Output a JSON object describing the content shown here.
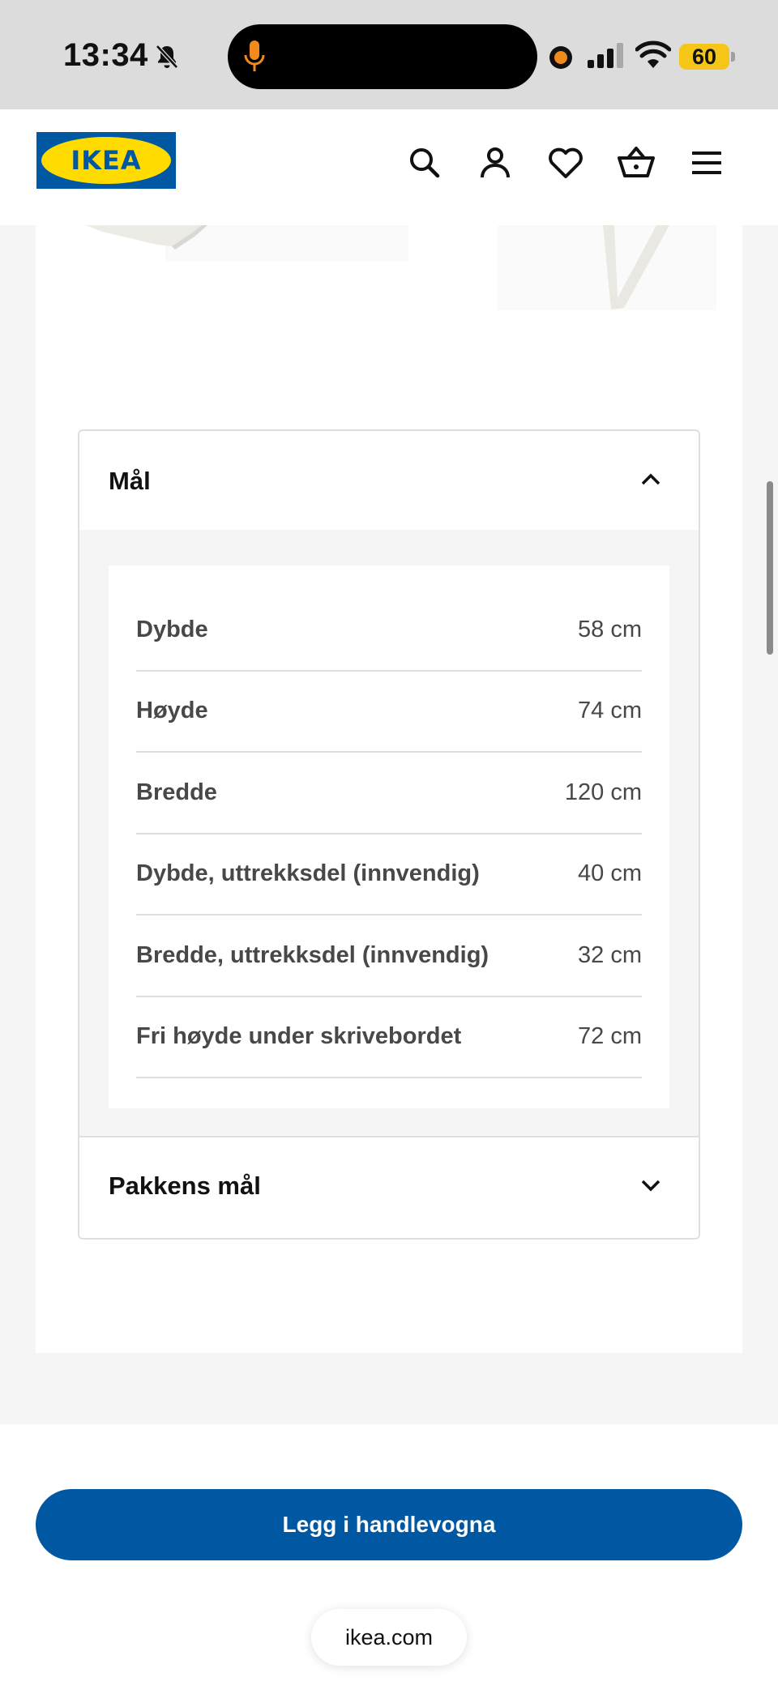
{
  "status_bar": {
    "time": "13:34",
    "battery": "60",
    "icons": [
      "bell-slash-icon",
      "microphone-icon",
      "recording-dot-icon",
      "signal-icon",
      "wifi-icon",
      "battery-icon"
    ],
    "battery_color": "#f5c518",
    "mic_color": "#f08a1c"
  },
  "header": {
    "logo_text": "IKEA",
    "brand_blue": "#0058a3",
    "brand_yellow": "#ffdb00",
    "icons": [
      "search-icon",
      "account-icon",
      "heart-icon",
      "basket-icon",
      "menu-icon"
    ]
  },
  "accordion": {
    "open_section": {
      "title": "Mål",
      "expanded": true,
      "rows": [
        {
          "label": "Dybde",
          "value": "58 cm"
        },
        {
          "label": "Høyde",
          "value": "74 cm"
        },
        {
          "label": "Bredde",
          "value": "120 cm"
        },
        {
          "label": "Dybde, uttrekksdel (innvendig)",
          "value": "40 cm"
        },
        {
          "label": "Bredde, uttrekksdel (innvendig)",
          "value": "32 cm"
        },
        {
          "label": "Fri høyde under skrivebordet",
          "value": "72 cm"
        }
      ]
    },
    "closed_section": {
      "title": "Pakkens mål",
      "expanded": false
    }
  },
  "cta": {
    "label": "Legg i handlevogna"
  },
  "browser": {
    "url": "ikea.com"
  }
}
